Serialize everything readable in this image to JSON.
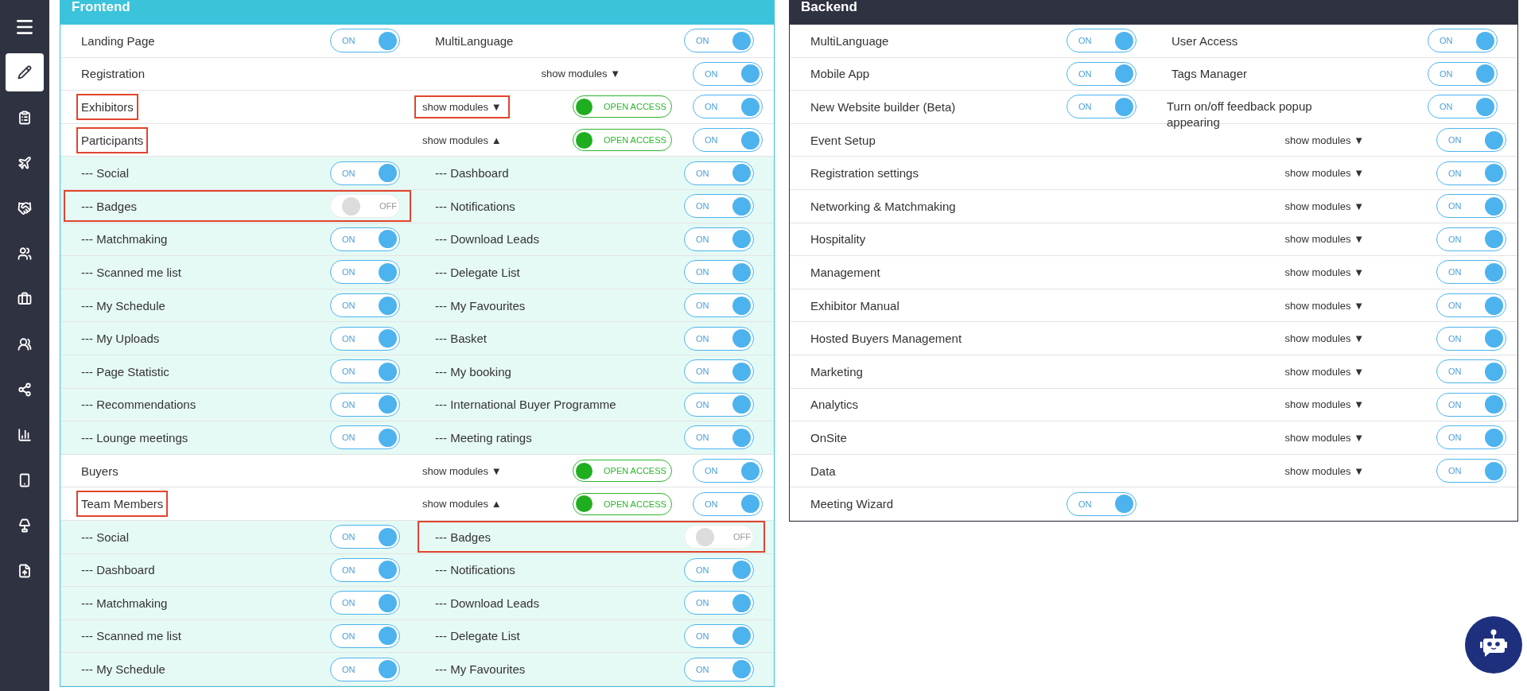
{
  "sidebar": {
    "items": [
      {
        "kind": "menu",
        "selected": false
      },
      {
        "kind": "pencil",
        "selected": true
      },
      {
        "kind": "list",
        "selected": false
      },
      {
        "kind": "plane",
        "selected": false
      },
      {
        "kind": "handshake",
        "selected": false
      },
      {
        "kind": "group",
        "selected": false
      },
      {
        "kind": "briefcase",
        "selected": false
      },
      {
        "kind": "users",
        "selected": false
      },
      {
        "kind": "share",
        "selected": false
      },
      {
        "kind": "chart",
        "selected": false
      },
      {
        "kind": "phone",
        "selected": false
      },
      {
        "kind": "lamp",
        "selected": false
      },
      {
        "kind": "upload",
        "selected": false
      }
    ]
  },
  "frontend": {
    "title": "Frontend",
    "rows": [
      {
        "kind": "pair",
        "sub": false,
        "cells": [
          {
            "label": "Landing Page",
            "highlight": false,
            "toggle": {
              "on": true,
              "text": "ON"
            }
          },
          {
            "label": "MultiLanguage",
            "highlight": false,
            "toggle": {
              "on": true,
              "text": "ON"
            }
          }
        ]
      },
      {
        "kind": "group",
        "sub": false,
        "label": "Registration",
        "label_highlight": false,
        "modules": "show modules ▼",
        "modules_highlight": false,
        "toggle": {
          "on": true,
          "text": "ON"
        }
      },
      {
        "kind": "group",
        "sub": false,
        "label": "Exhibitors",
        "label_highlight": true,
        "modules": "show modules ▼",
        "modules_highlight": true,
        "open_access": {
          "on": true,
          "text": "OPEN ACCESS"
        },
        "toggle": {
          "on": true,
          "text": "ON"
        }
      },
      {
        "kind": "group",
        "sub": false,
        "label": "Participants",
        "label_highlight": true,
        "modules": "show modules ▲",
        "modules_highlight": false,
        "open_access": {
          "on": true,
          "text": "OPEN ACCESS"
        },
        "toggle": {
          "on": true,
          "text": "ON"
        }
      },
      {
        "kind": "pair",
        "sub": true,
        "cells": [
          {
            "label": "--- Social",
            "highlight": false,
            "toggle": {
              "on": true,
              "text": "ON"
            }
          },
          {
            "label": "--- Dashboard",
            "highlight": false,
            "toggle": {
              "on": true,
              "text": "ON"
            }
          }
        ]
      },
      {
        "kind": "pair",
        "sub": true,
        "cells": [
          {
            "label": "--- Badges",
            "highlight": true,
            "toggle": {
              "on": false,
              "text": "OFF"
            }
          },
          {
            "label": "--- Notifications",
            "highlight": false,
            "toggle": {
              "on": true,
              "text": "ON"
            }
          }
        ]
      },
      {
        "kind": "pair",
        "sub": true,
        "cells": [
          {
            "label": "--- Matchmaking",
            "highlight": false,
            "toggle": {
              "on": true,
              "text": "ON"
            }
          },
          {
            "label": "--- Download Leads",
            "highlight": false,
            "toggle": {
              "on": true,
              "text": "ON"
            }
          }
        ]
      },
      {
        "kind": "pair",
        "sub": true,
        "cells": [
          {
            "label": "--- Scanned me list",
            "highlight": false,
            "toggle": {
              "on": true,
              "text": "ON"
            }
          },
          {
            "label": "--- Delegate List",
            "highlight": false,
            "toggle": {
              "on": true,
              "text": "ON"
            }
          }
        ]
      },
      {
        "kind": "pair",
        "sub": true,
        "cells": [
          {
            "label": "--- My Schedule",
            "highlight": false,
            "toggle": {
              "on": true,
              "text": "ON"
            }
          },
          {
            "label": "--- My Favourites",
            "highlight": false,
            "toggle": {
              "on": true,
              "text": "ON"
            }
          }
        ]
      },
      {
        "kind": "pair",
        "sub": true,
        "cells": [
          {
            "label": "--- My Uploads",
            "highlight": false,
            "toggle": {
              "on": true,
              "text": "ON"
            }
          },
          {
            "label": "--- Basket",
            "highlight": false,
            "toggle": {
              "on": true,
              "text": "ON"
            }
          }
        ]
      },
      {
        "kind": "pair",
        "sub": true,
        "cells": [
          {
            "label": "--- Page Statistic",
            "highlight": false,
            "toggle": {
              "on": true,
              "text": "ON"
            }
          },
          {
            "label": "--- My booking",
            "highlight": false,
            "toggle": {
              "on": true,
              "text": "ON"
            }
          }
        ]
      },
      {
        "kind": "pair",
        "sub": true,
        "cells": [
          {
            "label": "--- Recommendations",
            "highlight": false,
            "toggle": {
              "on": true,
              "text": "ON"
            }
          },
          {
            "label": "--- International Buyer Programme",
            "highlight": false,
            "toggle": {
              "on": true,
              "text": "ON"
            }
          }
        ]
      },
      {
        "kind": "pair",
        "sub": true,
        "cells": [
          {
            "label": "--- Lounge meetings",
            "highlight": false,
            "toggle": {
              "on": true,
              "text": "ON"
            }
          },
          {
            "label": "--- Meeting ratings",
            "highlight": false,
            "toggle": {
              "on": true,
              "text": "ON"
            }
          }
        ]
      },
      {
        "kind": "group",
        "sub": false,
        "label": "Buyers",
        "label_highlight": false,
        "modules": "show modules ▼",
        "modules_highlight": false,
        "open_access": {
          "on": true,
          "text": "OPEN ACCESS"
        },
        "toggle": {
          "on": true,
          "text": "ON"
        }
      },
      {
        "kind": "group",
        "sub": false,
        "label": "Team Members",
        "label_highlight": true,
        "modules": "show modules ▲",
        "modules_highlight": false,
        "open_access": {
          "on": true,
          "text": "OPEN ACCESS"
        },
        "toggle": {
          "on": true,
          "text": "ON"
        }
      },
      {
        "kind": "pair",
        "sub": true,
        "cells": [
          {
            "label": "--- Social",
            "highlight": false,
            "toggle": {
              "on": true,
              "text": "ON"
            }
          },
          {
            "label": "--- Badges",
            "highlight": true,
            "toggle": {
              "on": false,
              "text": "OFF"
            }
          }
        ]
      },
      {
        "kind": "pair",
        "sub": true,
        "cells": [
          {
            "label": "--- Dashboard",
            "highlight": false,
            "toggle": {
              "on": true,
              "text": "ON"
            }
          },
          {
            "label": "--- Notifications",
            "highlight": false,
            "toggle": {
              "on": true,
              "text": "ON"
            }
          }
        ]
      },
      {
        "kind": "pair",
        "sub": true,
        "cells": [
          {
            "label": "--- Matchmaking",
            "highlight": false,
            "toggle": {
              "on": true,
              "text": "ON"
            }
          },
          {
            "label": "--- Download Leads",
            "highlight": false,
            "toggle": {
              "on": true,
              "text": "ON"
            }
          }
        ]
      },
      {
        "kind": "pair",
        "sub": true,
        "cells": [
          {
            "label": "--- Scanned me list",
            "highlight": false,
            "toggle": {
              "on": true,
              "text": "ON"
            }
          },
          {
            "label": "--- Delegate List",
            "highlight": false,
            "toggle": {
              "on": true,
              "text": "ON"
            }
          }
        ]
      },
      {
        "kind": "pair",
        "sub": true,
        "cells": [
          {
            "label": "--- My Schedule",
            "highlight": false,
            "toggle": {
              "on": true,
              "text": "ON"
            }
          },
          {
            "label": "--- My Favourites",
            "highlight": false,
            "toggle": {
              "on": true,
              "text": "ON"
            }
          }
        ]
      }
    ]
  },
  "backend": {
    "title": "Backend",
    "rows": [
      {
        "kind": "pair",
        "cells": [
          {
            "label": "MultiLanguage",
            "toggle": {
              "on": true,
              "text": "ON"
            }
          },
          {
            "label": "User Access",
            "toggle": {
              "on": true,
              "text": "ON"
            }
          }
        ]
      },
      {
        "kind": "pair",
        "cells": [
          {
            "label": "Mobile App",
            "toggle": {
              "on": true,
              "text": "ON"
            }
          },
          {
            "label": "Tags Manager",
            "toggle": {
              "on": true,
              "text": "ON"
            }
          }
        ]
      },
      {
        "kind": "pair",
        "cells": [
          {
            "label": "New Website builder (Beta)",
            "toggle": {
              "on": true,
              "text": "ON"
            }
          },
          {
            "label": "Turn on/off feedback popup appearing",
            "toggle": {
              "on": true,
              "text": "ON"
            }
          }
        ]
      },
      {
        "kind": "group",
        "label": "Event Setup",
        "modules": "show modules ▼",
        "toggle": {
          "on": true,
          "text": "ON"
        }
      },
      {
        "kind": "group",
        "label": "Registration settings",
        "modules": "show modules ▼",
        "toggle": {
          "on": true,
          "text": "ON"
        }
      },
      {
        "kind": "group",
        "label": "Networking & Matchmaking",
        "modules": "show modules ▼",
        "toggle": {
          "on": true,
          "text": "ON"
        }
      },
      {
        "kind": "group",
        "label": "Hospitality",
        "modules": "show modules ▼",
        "toggle": {
          "on": true,
          "text": "ON"
        }
      },
      {
        "kind": "group",
        "label": "Management",
        "modules": "show modules ▼",
        "toggle": {
          "on": true,
          "text": "ON"
        }
      },
      {
        "kind": "group",
        "label": "Exhibitor Manual",
        "modules": "show modules ▼",
        "toggle": {
          "on": true,
          "text": "ON"
        }
      },
      {
        "kind": "group",
        "label": "Hosted Buyers Management",
        "modules": "show modules ▼",
        "toggle": {
          "on": true,
          "text": "ON"
        }
      },
      {
        "kind": "group",
        "label": "Marketing",
        "modules": "show modules ▼",
        "toggle": {
          "on": true,
          "text": "ON"
        }
      },
      {
        "kind": "group",
        "label": "Analytics",
        "modules": "show modules ▼",
        "toggle": {
          "on": true,
          "text": "ON"
        }
      },
      {
        "kind": "group",
        "label": "OnSite",
        "modules": "show modules ▼",
        "toggle": {
          "on": true,
          "text": "ON"
        }
      },
      {
        "kind": "group",
        "label": "Data",
        "modules": "show modules ▼",
        "toggle": {
          "on": true,
          "text": "ON"
        }
      },
      {
        "kind": "pair",
        "cells": [
          {
            "label": "Meeting Wizard",
            "toggle": {
              "on": true,
              "text": "ON"
            }
          }
        ]
      }
    ]
  }
}
